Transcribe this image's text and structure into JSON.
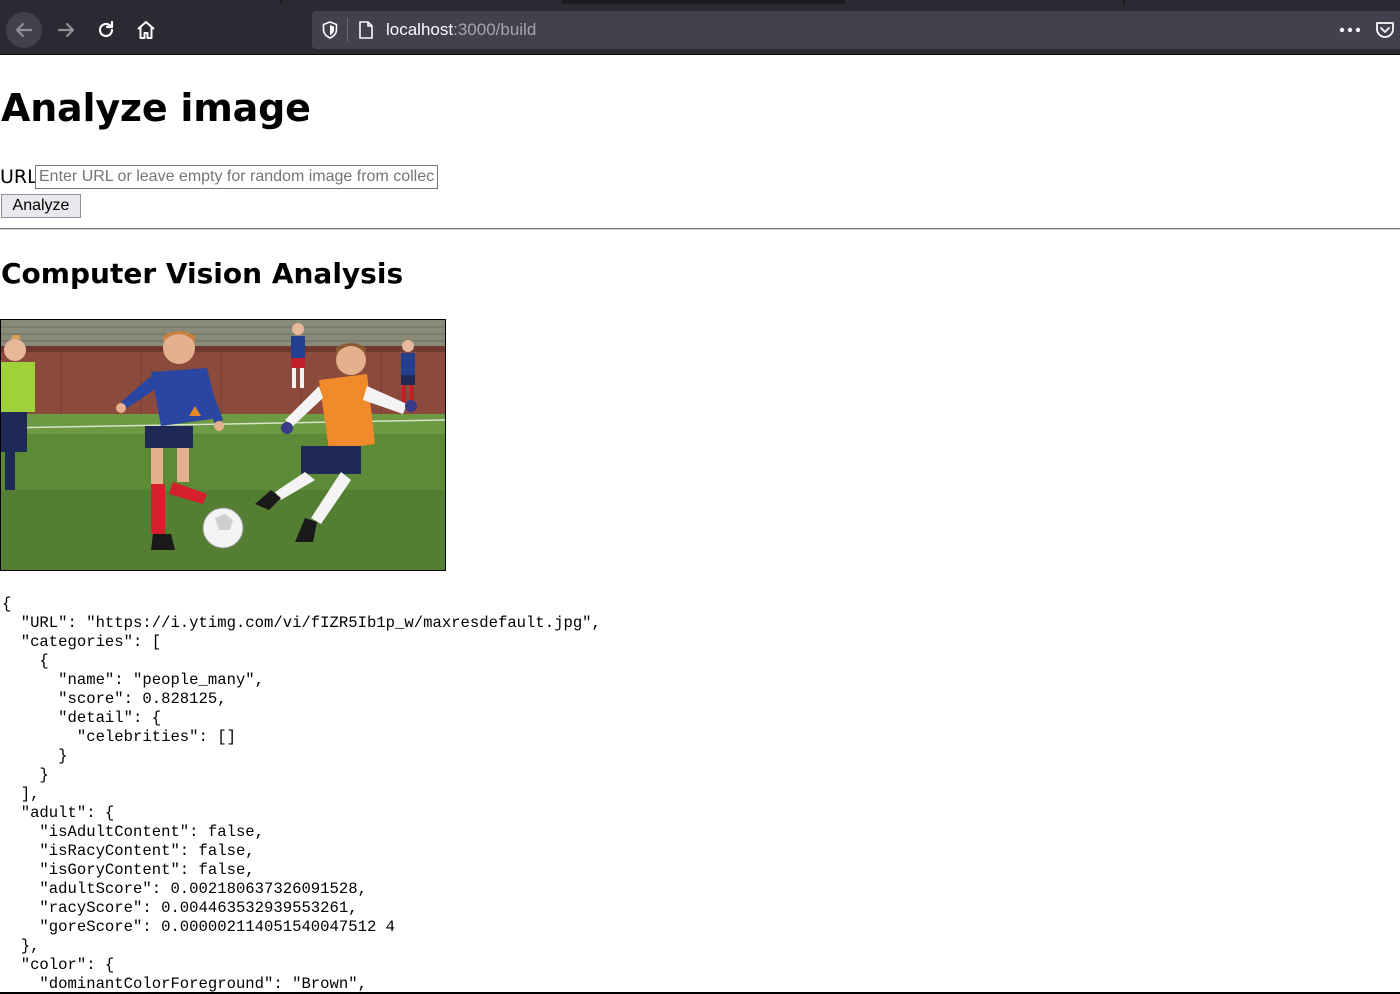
{
  "browser": {
    "url_host": "localhost",
    "url_path": ":3000/build"
  },
  "page": {
    "title": "Analyze image",
    "url_label": "URL",
    "url_placeholder": "Enter URL or leave empty for random image from collection",
    "analyze_label": "Analyze",
    "section_title": "Computer Vision Analysis",
    "image_subject": "children playing soccer on grass",
    "result_json": "{\n  \"URL\": \"https://i.ytimg.com/vi/fIZR5Ib1p_w/maxresdefault.jpg\",\n  \"categories\": [\n    {\n      \"name\": \"people_many\",\n      \"score\": 0.828125,\n      \"detail\": {\n        \"celebrities\": []\n      }\n    }\n  ],\n  \"adult\": {\n    \"isAdultContent\": false,\n    \"isRacyContent\": false,\n    \"isGoryContent\": false,\n    \"adultScore\": 0.002180637326091528,\n    \"racyScore\": 0.004463532939553261,\n    \"goreScore\": 0.000002114051540047512 4\n  },\n  \"color\": {\n    \"dominantColorForeground\": \"Brown\","
  },
  "icons": {
    "back": "arrow-left-icon",
    "forward": "arrow-right-icon",
    "reload": "reload-icon",
    "home": "home-icon",
    "shield": "shield-icon",
    "page": "page-icon",
    "more": "more-dots-icon",
    "pocket": "pocket-icon"
  },
  "colors": {
    "chrome_bg": "#2b2a33",
    "urlbar_bg": "#42414d",
    "page_bg": "#ffffff"
  }
}
